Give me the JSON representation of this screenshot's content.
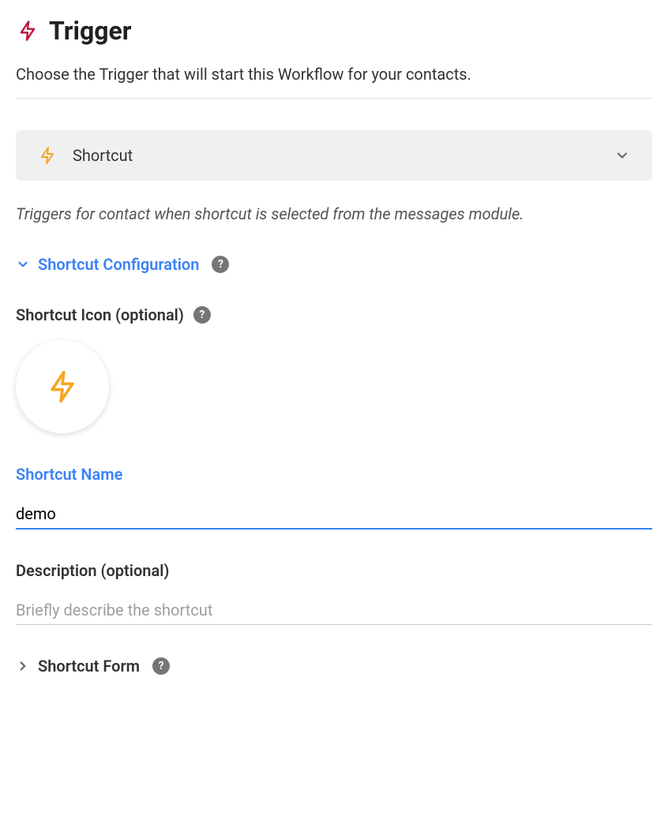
{
  "header": {
    "title": "Trigger"
  },
  "description": "Choose the Trigger that will start this Workflow for your contacts.",
  "triggerSelector": {
    "selected": "Shortcut"
  },
  "triggerHint": "Triggers for contact when shortcut is selected from the messages module.",
  "sections": {
    "configuration": {
      "title": "Shortcut Configuration"
    },
    "form": {
      "title": "Shortcut Form"
    }
  },
  "fields": {
    "shortcutIcon": {
      "label": "Shortcut Icon (optional)"
    },
    "shortcutName": {
      "label": "Shortcut Name",
      "value": "demo"
    },
    "description": {
      "label": "Description (optional)",
      "placeholder": "Briefly describe the shortcut",
      "value": ""
    }
  },
  "colors": {
    "accent": "#3b82f6",
    "headerIcon": "#be123c",
    "boltIcon": "#f5a623"
  }
}
